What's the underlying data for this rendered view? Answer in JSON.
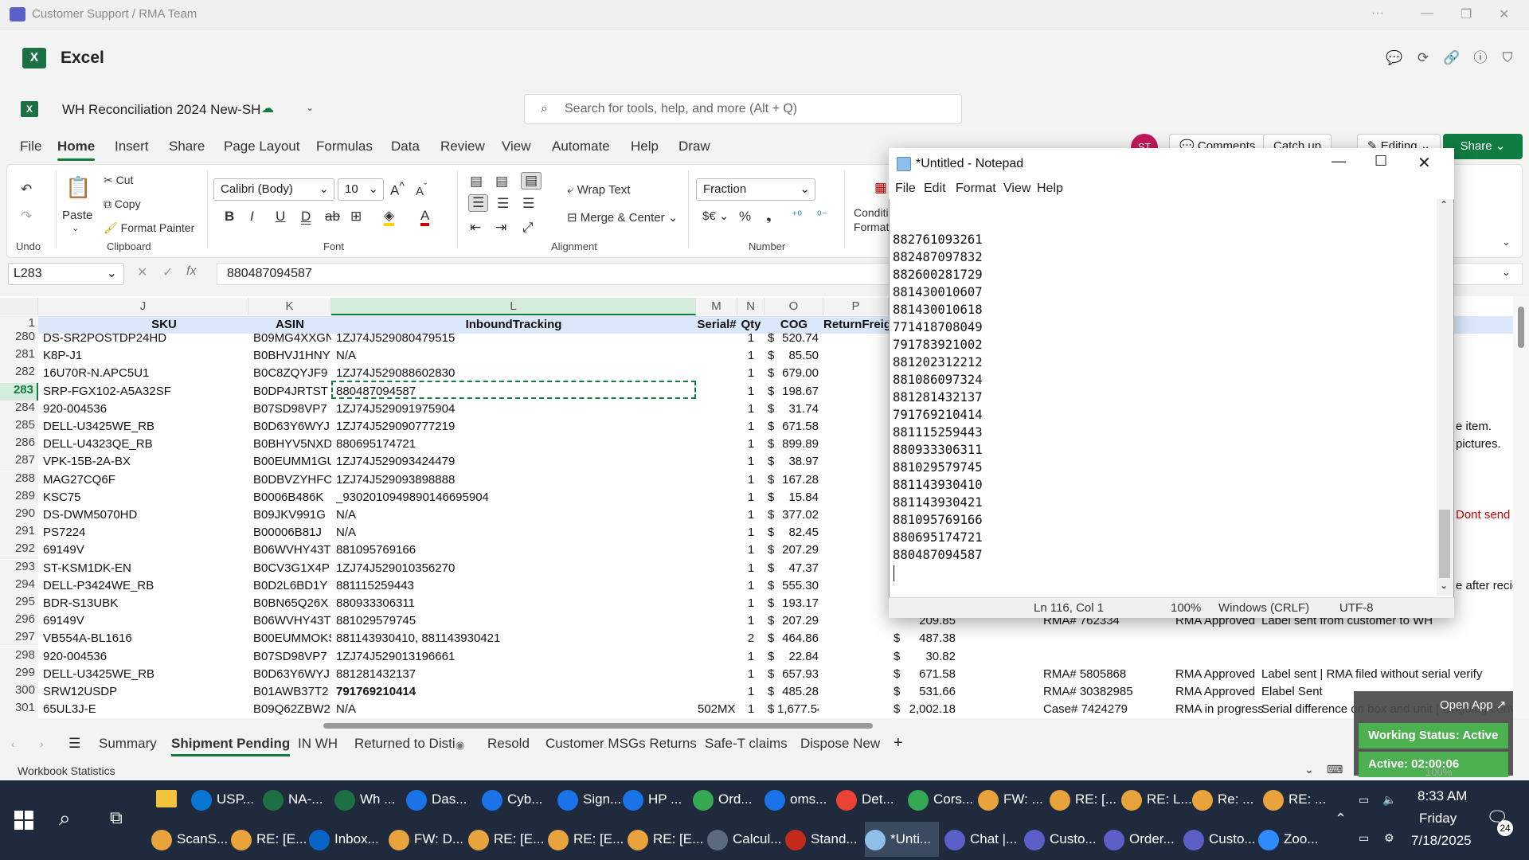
{
  "teams": {
    "title": "Customer Support / RMA Team"
  },
  "excel": {
    "app_name": "Excel",
    "doc_name": "WH Reconciliation 2024 New-SH",
    "search_placeholder": "Search for tools, help, and more (Alt + Q)",
    "avatar": "ST",
    "comments": "Comments",
    "catchup": "Catch up",
    "editing": "Editing",
    "share": "Share"
  },
  "ribbon_tabs": [
    "File",
    "Home",
    "Insert",
    "Share",
    "Page Layout",
    "Formulas",
    "Data",
    "Review",
    "View",
    "Automate",
    "Help",
    "Draw"
  ],
  "ribbon": {
    "undo_label": "Undo",
    "paste": "Paste",
    "cut": "Cut",
    "copy": "Copy",
    "format_painter": "Format Painter",
    "clipboard": "Clipboard",
    "font_name": "Calibri (Body)",
    "font_size": "10",
    "font": "Font",
    "wrap_text": "Wrap Text",
    "merge_center": "Merge & Center",
    "alignment": "Alignment",
    "number_format": "Fraction",
    "number": "Number",
    "cond_format": "Conditi Formatt"
  },
  "formula_bar": {
    "name_box": "L283",
    "formula": "880487094587"
  },
  "columns": [
    "J",
    "K",
    "L",
    "M",
    "N",
    "O",
    "P"
  ],
  "headers": {
    "sku": "SKU",
    "asin": "ASIN",
    "tracking": "InboundTracking",
    "serial": "Serial#",
    "qty": "Qty",
    "cog": "COG",
    "freight": "ReturnFreigh"
  },
  "rows": [
    {
      "num": "280",
      "sku": "DS-SR2POSTDP24HD",
      "asin": "B09MG4XXGN",
      "trk": "1ZJ74J529080479515",
      "qty": "1",
      "cog": "520.74"
    },
    {
      "num": "281",
      "sku": "K8P-J1",
      "asin": "B0BHVJ1HNY",
      "trk": "N/A",
      "qty": "1",
      "cog": "85.50"
    },
    {
      "num": "282",
      "sku": "16U70R-N.APC5U1",
      "asin": "B0C8ZQYJF9",
      "trk": "1ZJ74J529088602830",
      "qty": "1",
      "cog": "679.00"
    },
    {
      "num": "283",
      "sku": "SRP-FGX102-A5A32SF",
      "asin": "B0DP4JRTST",
      "trk": "880487094587",
      "qty": "1",
      "cog": "198.67"
    },
    {
      "num": "284",
      "sku": "920-004536",
      "asin": "B07SD98VP7",
      "trk": "1ZJ74J529091975904",
      "qty": "1",
      "cog": "31.74"
    },
    {
      "num": "285",
      "sku": "DELL-U3425WE_RB",
      "asin": "B0D63Y6WYJ",
      "trk": "1ZJ74J529090777219",
      "qty": "1",
      "cog": "671.58"
    },
    {
      "num": "286",
      "sku": "DELL-U4323QE_RB",
      "asin": "B0BHYV5NXD",
      "trk": "880695174721",
      "qty": "1",
      "cog": "899.89"
    },
    {
      "num": "287",
      "sku": "VPK-15B-2A-BX",
      "asin": "B00EUMM1GU",
      "trk": "1ZJ74J529093424479",
      "qty": "1",
      "cog": "38.97"
    },
    {
      "num": "288",
      "sku": "MAG27CQ6F",
      "asin": "B0DBVZYHFC",
      "trk": "1ZJ74J529093898888",
      "qty": "1",
      "cog": "167.28"
    },
    {
      "num": "289",
      "sku": "KSC75",
      "asin": "B0006B486K",
      "trk": "_930201094989014669590​4",
      "qty": "1",
      "cog": "15.84"
    },
    {
      "num": "290",
      "sku": "DS-DWM5070HD",
      "asin": "B09JKV991G",
      "trk": "N/A",
      "qty": "1",
      "cog": "377.02"
    },
    {
      "num": "291",
      "sku": "PS7224",
      "asin": "B00006B81J",
      "trk": "N/A",
      "qty": "1",
      "cog": "82.45"
    },
    {
      "num": "292",
      "sku": "69149V",
      "asin": "B06WVHY43T",
      "trk": "881095769166",
      "qty": "1",
      "cog": "207.29"
    },
    {
      "num": "293",
      "sku": "ST-KSM1DK-EN",
      "asin": "B0CV3G1X4P",
      "trk": "1ZJ74J529010356270",
      "qty": "1",
      "cog": "47.37"
    },
    {
      "num": "294",
      "sku": "DELL-P3424WE_RB",
      "asin": "B0D2L6BD1Y",
      "trk": "881115259443",
      "qty": "1",
      "cog": "555.30"
    },
    {
      "num": "295",
      "sku": "BDR-S13UBK",
      "asin": "B0BN65Q26X",
      "trk": "880933306311",
      "qty": "1",
      "cog": "193.17"
    },
    {
      "num": "296",
      "sku": "69149V",
      "asin": "B06WVHY43T",
      "trk": "881029579745",
      "qty": "1",
      "cog": "207.29"
    },
    {
      "num": "297",
      "sku": "VB554A-BL1616",
      "asin": "B00EUMMOKS",
      "trk": "881143930410, 881143930421",
      "qty": "2",
      "cog": "464.86"
    },
    {
      "num": "298",
      "sku": "920-004536",
      "asin": "B07SD98VP7",
      "trk": "1ZJ74J529013196661",
      "qty": "1",
      "cog": "22.84"
    },
    {
      "num": "299",
      "sku": "DELL-U3425WE_RB",
      "asin": "B0D63Y6WYJ",
      "trk": "881281432137",
      "qty": "1",
      "cog": "657.93"
    },
    {
      "num": "300",
      "sku": "SRW12USDP",
      "asin": "B01AWB37T2",
      "trk": "791769210414",
      "qty": "1",
      "cog": "485.28"
    },
    {
      "num": "301",
      "sku": "65UL3J-E",
      "asin": "B09Q62ZBW2",
      "trk": "N/A",
      "serial": "502MX",
      "qty": "1",
      "cog": "1,677.54"
    }
  ],
  "right_cells": [
    {
      "row": "285",
      "text": "e item."
    },
    {
      "row": "286",
      "text": "pictures."
    },
    {
      "row": "290",
      "text": "Dont send l"
    },
    {
      "row": "294",
      "text": "e after reciev"
    }
  ],
  "lower_rows": [
    {
      "row": "296",
      "amt": "209.85",
      "rma": "RMA# 762334",
      "status": "RMA Approved",
      "note": "Label sent from customer to WH"
    },
    {
      "row": "297",
      "amt": "487.38",
      "rma": "",
      "status": "",
      "note": ""
    },
    {
      "row": "298",
      "amt": "30.82",
      "rma": "",
      "status": "",
      "note": ""
    },
    {
      "row": "299",
      "amt": "671.58",
      "rma": "RMA# 5805868",
      "status": "RMA Approved",
      "note": "Label sent | RMA filed without serial verify"
    },
    {
      "row": "300",
      "amt": "531.66",
      "rma": "RMA# 30382985",
      "status": "RMA Approved",
      "note": "Elabel Sent"
    },
    {
      "row": "301",
      "amt": "2,002.18",
      "rma": "Case# 7424279",
      "status": "RMA in progress",
      "note": "Serial difference on box and unit | Ongoing convo"
    }
  ],
  "notepad": {
    "title": "*Untitled - Notepad",
    "menu": [
      "File",
      "Edit",
      "Format",
      "View",
      "Help"
    ],
    "lines": [
      "882761093261",
      "882487097832",
      "882600281729",
      "881430010607",
      "881430010618",
      "771418708049",
      "791783921002",
      "881202312212",
      "881086097324",
      "881281432137",
      "791769210414",
      "881115259443",
      "880933306311",
      "881029579745",
      "881143930410",
      "881143930421",
      "881095769166",
      "880695174721",
      "880487094587"
    ],
    "status_pos": "Ln 116, Col 1",
    "status_zoom": "100%",
    "status_eol": "Windows (CRLF)",
    "status_enc": "UTF-8"
  },
  "sheet_tabs": [
    "Summary",
    "Shipment Pending",
    "IN WH",
    "Returned to Disti",
    "Resold",
    "Customer MSGs Returns",
    "Safe-T claims",
    "Dispose New"
  ],
  "status_bar": {
    "left": "Workbook Statistics"
  },
  "zoom_widget": {
    "open_app": "Open App",
    "working": "Working Status: Active",
    "active": "Active: 02:00:06",
    "pct": "100%"
  },
  "taskbar": {
    "row1": [
      "USP...",
      "NA-...",
      "Wh ...",
      "Das...",
      "Cyb...",
      "Sign...",
      "HP ...",
      "Ord...",
      "oms...",
      "Det...",
      "Cors...",
      "FW: ...",
      "RE: [...",
      "RE: L...",
      "Re: ...",
      "RE: ..."
    ],
    "row2": [
      "ScanS...",
      "RE: [E...",
      "Inbox...",
      "FW: D...",
      "RE: [E...",
      "RE: [E...",
      "RE: [E...",
      "Calcul...",
      "Stand...",
      "*Unti...",
      "Chat |...",
      "Custo...",
      "Order...",
      "Custo...",
      "Zoo..."
    ],
    "time": "8:33 AM",
    "day": "Friday",
    "date": "7/18/2025",
    "notif": "24"
  }
}
